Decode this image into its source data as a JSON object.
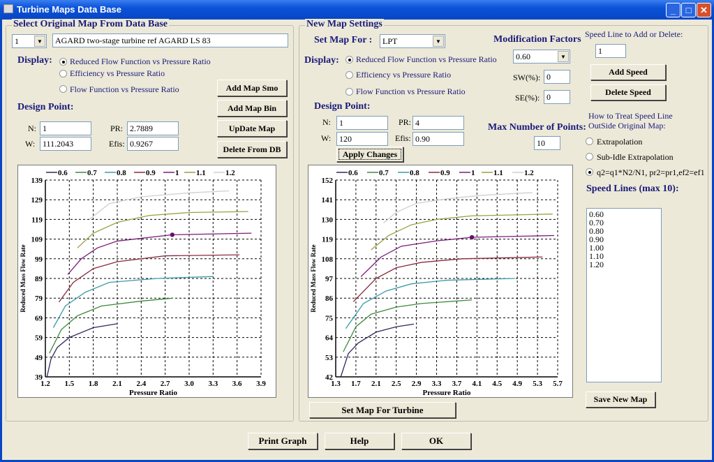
{
  "window": {
    "title": "Turbine Maps Data Base"
  },
  "left": {
    "group_title": "Select Original Map From Data Base",
    "map_index": "1",
    "map_name": "AGARD two-stage turbine ref AGARD LS 83",
    "display_label": "Display:",
    "display_options": [
      {
        "label": "Reduced  Flow Function vs Pressure Ratio",
        "selected": true
      },
      {
        "label": "Efficiency vs Pressure Ratio",
        "selected": false
      },
      {
        "label": "Flow Function vs Pressure Ratio",
        "selected": false
      }
    ],
    "design_point_label": "Design Point:",
    "fields": {
      "n_label": "N:",
      "n": "1",
      "pr_label": "PR:",
      "pr": "2.7889",
      "w_label": "W:",
      "w": "111.2043",
      "efis_label": "Efis:",
      "efis": "0.9267"
    },
    "buttons": {
      "add_smo": "Add Map Smo",
      "add_bin": "Add Map Bin",
      "update": "UpDate Map",
      "delete": "Delete From DB"
    }
  },
  "right": {
    "group_title": "New Map Settings",
    "set_map_label": "Set Map For :",
    "set_map_value": "LPT",
    "display_label": "Display:",
    "display_options": [
      {
        "label": "Reduced Flow Function vs Pressure Ratio",
        "selected": true
      },
      {
        "label": "Efficiency vs Pressure Ratio",
        "selected": false
      },
      {
        "label": "Flow Function vs Pressure Ratio",
        "selected": false
      }
    ],
    "design_point_label": "Design Point:",
    "fields": {
      "n_label": "N:",
      "n": "1",
      "pr_label": "PR:",
      "pr": "4",
      "w_label": "W:",
      "w": "120",
      "efis_label": "Efis:",
      "efis": "0.90"
    },
    "apply": "Apply Changes",
    "mod_factors_label": "Modification Factors",
    "mod_factor_value": "0.60",
    "sw_label": "SW(%):",
    "sw": "0",
    "se_label": "SE(%):",
    "se": "0",
    "max_points_label": "Max Number of Points:",
    "max_points": "10",
    "speed_line_label": "Speed Line to Add or Delete:",
    "speed_line": "1",
    "add_speed": "Add Speed",
    "delete_speed": "Delete Speed",
    "treat_label_1": "How to Treat Speed Line",
    "treat_label_2": "OutSide Original Map:",
    "treat_options": [
      {
        "label": "Extrapolation",
        "selected": false
      },
      {
        "label": "Sub-Idle Extrapolation",
        "selected": false
      },
      {
        "label": "q2=q1*N2/N1, pr2=pr1,ef2=ef1",
        "selected": true
      }
    ],
    "speed_lines_label": "Speed Lines (max 10):",
    "speed_lines": [
      "0.60",
      "0.70",
      "0.80",
      "0.90",
      "1.00",
      "1.10",
      "1.20"
    ],
    "save": "Save New Map",
    "set_map_turbine": "Set Map For Turbine"
  },
  "bottom": {
    "print": "Print Graph",
    "help": "Help",
    "ok": "OK"
  },
  "chart_data": [
    {
      "type": "line",
      "xlabel": "Pressure Ratio",
      "ylabel": "Reduced Mass Flow Rate",
      "xlim": [
        1.2,
        3.9
      ],
      "ylim": [
        39,
        139
      ],
      "xticks": [
        "1.2",
        "1.5",
        "1.8",
        "2.1",
        "2.4",
        "2.7",
        "3.0",
        "3.3",
        "3.6",
        "3.9"
      ],
      "yticks": [
        "39",
        "49",
        "59",
        "69",
        "79",
        "89",
        "99",
        "109",
        "119",
        "129",
        "139"
      ],
      "grid": true,
      "legend": "top",
      "series": [
        {
          "name": "0.6",
          "color": "#33285e",
          "points": [
            [
              1.22,
              39
            ],
            [
              1.27,
              48
            ],
            [
              1.35,
              54
            ],
            [
              1.5,
              59
            ],
            [
              1.8,
              64
            ],
            [
              2.1,
              66
            ]
          ]
        },
        {
          "name": "0.7",
          "color": "#3d8a3d",
          "points": [
            [
              1.25,
              51
            ],
            [
              1.4,
              63
            ],
            [
              1.6,
              70
            ],
            [
              1.9,
              75
            ],
            [
              2.4,
              77.5
            ],
            [
              2.8,
              79
            ]
          ]
        },
        {
          "name": "0.8",
          "color": "#3b9aa8",
          "points": [
            [
              1.3,
              64
            ],
            [
              1.45,
              75
            ],
            [
              1.7,
              82
            ],
            [
              2.0,
              87
            ],
            [
              2.6,
              89
            ],
            [
              3.3,
              90
            ]
          ]
        },
        {
          "name": "0.9",
          "color": "#8a2a3e",
          "points": [
            [
              1.37,
              77
            ],
            [
              1.55,
              87
            ],
            [
              1.8,
              94
            ],
            [
              2.1,
              97.5
            ],
            [
              2.7,
              100.5
            ],
            [
              3.63,
              101
            ]
          ]
        },
        {
          "name": "1",
          "color": "#7a1a7a",
          "points": [
            [
              1.48,
              91
            ],
            [
              1.65,
              99
            ],
            [
              1.85,
              104.5
            ],
            [
              2.1,
              108
            ],
            [
              2.79,
              111.2
            ],
            [
              3.78,
              112
            ]
          ]
        },
        {
          "name": "1.1",
          "color": "#9aa040",
          "points": [
            [
              1.6,
              104.5
            ],
            [
              1.8,
              112
            ],
            [
              2.1,
              117.5
            ],
            [
              2.5,
              121
            ],
            [
              3.0,
              122.5
            ],
            [
              3.74,
              123
            ]
          ]
        },
        {
          "name": "1.2",
          "color": "#cfcfcf",
          "points": [
            [
              1.75,
              119
            ],
            [
              2.0,
              127
            ],
            [
              2.4,
              130.5
            ],
            [
              3.0,
              132.5
            ],
            [
              3.5,
              133.5
            ]
          ]
        }
      ],
      "design_point": {
        "x": 2.7889,
        "y": 111.2,
        "color": "#6a106a"
      }
    },
    {
      "type": "line",
      "xlabel": "Pressure Ratio",
      "ylabel": "Reduced Mass Flow Rate",
      "xlim": [
        1.3,
        5.7
      ],
      "ylim": [
        42,
        152
      ],
      "xticks": [
        "1.3",
        "1.7",
        "2.1",
        "2.5",
        "2.9",
        "3.3",
        "3.7",
        "4.1",
        "4.5",
        "4.9",
        "5.3",
        "5.7"
      ],
      "yticks": [
        "42",
        "53",
        "64",
        "75",
        "86",
        "97",
        "108",
        "119",
        "130",
        "141",
        "152"
      ],
      "grid": true,
      "legend": "top",
      "series": [
        {
          "name": "0.6",
          "color": "#33285e",
          "points": [
            [
              1.4,
              42
            ],
            [
              1.55,
              55
            ],
            [
              1.75,
              61
            ],
            [
              2.1,
              67
            ],
            [
              2.5,
              70
            ],
            [
              2.85,
              71.5
            ]
          ]
        },
        {
          "name": "0.7",
          "color": "#3d8a3d",
          "points": [
            [
              1.45,
              56
            ],
            [
              1.7,
              70
            ],
            [
              2.0,
              77
            ],
            [
              2.5,
              81
            ],
            [
              3.0,
              83
            ],
            [
              4.0,
              85
            ]
          ]
        },
        {
          "name": "0.8",
          "color": "#3b9aa8",
          "points": [
            [
              1.5,
              69
            ],
            [
              1.85,
              83
            ],
            [
              2.3,
              90
            ],
            [
              2.8,
              94
            ],
            [
              3.5,
              96
            ],
            [
              4.85,
              97
            ]
          ]
        },
        {
          "name": "0.9",
          "color": "#8a2a3e",
          "points": [
            [
              1.65,
              84
            ],
            [
              2.1,
              97
            ],
            [
              2.5,
              103
            ],
            [
              3.0,
              106
            ],
            [
              3.8,
              108
            ],
            [
              5.4,
              109
            ]
          ]
        },
        {
          "name": "1",
          "color": "#7a1a7a",
          "points": [
            [
              1.8,
              98
            ],
            [
              2.2,
              109
            ],
            [
              2.6,
              115
            ],
            [
              3.3,
              118
            ],
            [
              4.0,
              120
            ],
            [
              5.63,
              121
            ]
          ]
        },
        {
          "name": "1.1",
          "color": "#9aa040",
          "points": [
            [
              2.0,
              113
            ],
            [
              2.35,
              121
            ],
            [
              2.8,
              127
            ],
            [
              3.3,
              130
            ],
            [
              4.0,
              132
            ],
            [
              5.6,
              133
            ]
          ]
        },
        {
          "name": "1.2",
          "color": "#cfcfcf",
          "points": [
            [
              2.25,
              128
            ],
            [
              2.5,
              134
            ],
            [
              2.9,
              139
            ],
            [
              3.5,
              141.5
            ],
            [
              4.2,
              143.5
            ],
            [
              5.2,
              145
            ]
          ]
        }
      ],
      "design_point": {
        "x": 4.0,
        "y": 120,
        "color": "#6a106a"
      }
    }
  ]
}
